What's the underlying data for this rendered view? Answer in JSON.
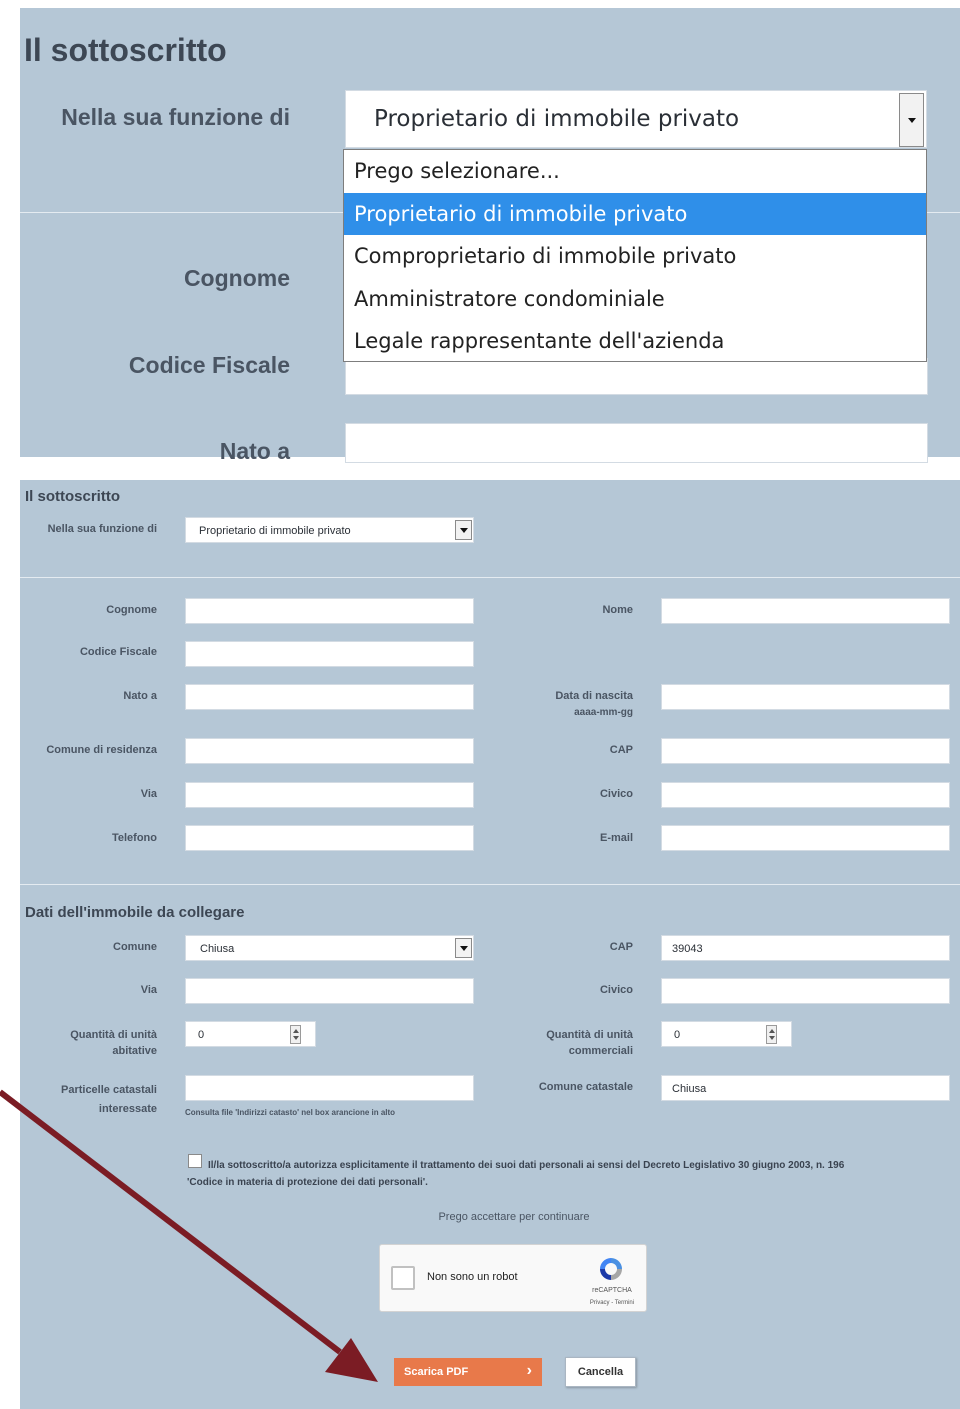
{
  "zoom": {
    "section_title": "Il sottoscritto",
    "role_label": "Nella sua funzione di",
    "role_value": "Proprietario di immobile privato",
    "dropdown_options": [
      "Prego selezionare...",
      "Proprietario di immobile privato",
      "Comproprietario di immobile privato",
      "Amministratore condominiale",
      "Legale rappresentante dell'azienda"
    ],
    "cognome_label": "Cognome",
    "codice_fiscale_label": "Codice Fiscale",
    "nato_label": "Nato a"
  },
  "form": {
    "section_title": "Il sottoscritto",
    "role_label": "Nella sua funzione di",
    "role_value": "Proprietario di immobile privato",
    "cognome_label": "Cognome",
    "nome_label": "Nome",
    "codice_fiscale_label": "Codice Fiscale",
    "nato_label": "Nato a",
    "data_nascita_label": "Data di nascita",
    "data_nascita_hint": "aaaa-mm-gg",
    "comune_residenza_label": "Comune di residenza",
    "cap_label": "CAP",
    "via_label": "Via",
    "civico_label": "Civico",
    "telefono_label": "Telefono",
    "email_label": "E-mail"
  },
  "property": {
    "section_title": "Dati dell'immobile da collegare",
    "comune_label": "Comune",
    "comune_value": "Chiusa",
    "cap_label": "CAP",
    "cap_value": "39043",
    "via_label": "Via",
    "civico_label": "Civico",
    "unita_abitative_label_1": "Quantità di unità",
    "unita_abitative_label_2": "abitative",
    "unita_abitative_value": "0",
    "unita_commerciali_label_1": "Quantità di unità",
    "unita_commerciali_label_2": "commerciali",
    "unita_commerciali_value": "0",
    "particelle_label_1": "Particelle catastali",
    "particelle_label_2": "interessate",
    "particelle_hint": "Consulta file 'Indirizzi catasto' nel box arancione in alto",
    "comune_catastale_label": "Comune catastale",
    "comune_catastale_value": "Chiusa"
  },
  "consent": {
    "line1": "Il/la sottoscritto/a autorizza esplicitamente il trattamento dei suoi dati personali ai sensi del Decreto Legislativo 30 giugno 2003, n. 196",
    "line2": "'Codice in materia di protezione dei dati personali'.",
    "prompt": "Prego accettare per continuare"
  },
  "captcha": {
    "label": "Non sono un robot",
    "brand": "reCAPTCHA",
    "links": "Privacy - Termini"
  },
  "actions": {
    "download_label": "Scarica PDF",
    "cancel_label": "Cancella"
  },
  "colors": {
    "panel": "#b5c7d6",
    "accent_button": "#e8794a",
    "arrow": "#7b1c24",
    "dropdown_highlight": "#2f8fe9"
  }
}
